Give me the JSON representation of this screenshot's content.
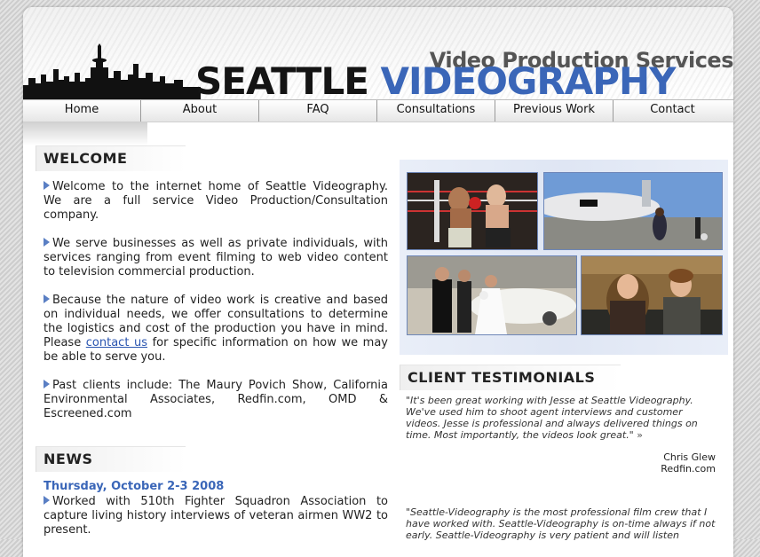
{
  "header": {
    "tagline": "Video Production Services",
    "brand_part1": "SEATTLE ",
    "brand_part2": "VIDEOGRAPHY"
  },
  "nav": [
    {
      "label": "Home"
    },
    {
      "label": "About"
    },
    {
      "label": "FAQ"
    },
    {
      "label": "Consultations"
    },
    {
      "label": "Previous Work"
    },
    {
      "label": "Contact"
    }
  ],
  "welcome": {
    "title": "WELCOME",
    "p1": "Welcome to the internet home of Seattle Videography. We are a full service Video Production/Consultation company.",
    "p2": "We serve businesses as well as private individuals, with services ranging from event filming to web video content to television commercial production.",
    "p3_before": "Because the nature of video work is creative and based on individual needs, we offer consultations to determine the logistics and cost of the production you have in mind. Please ",
    "p3_link": "contact us",
    "p3_after": " for specific information on how we may be able to serve you.",
    "p4": "Past clients include: The Maury Povich Show, California Environmental Associates, Redfin.com, OMD & Escreened.com"
  },
  "news": {
    "title": "NEWS",
    "date": "Thursday, October 2-3 2008",
    "text": "Worked with 510th Fighter Squadron Association to capture living history interviews of veteran airmen WW2 to present."
  },
  "testimonials": {
    "title": "CLIENT TESTIMONIALS",
    "quote1": "\"It's been great working with Jesse at Seattle Videography. We've used him to shoot agent interviews and customer videos. Jesse is professional and always delivered things on time. Most importantly, the videos look great.\"",
    "more_icon": "double-chevron-right-icon",
    "author1_name": "Chris Glew",
    "author1_company": "Redfin.com",
    "quote2": "\"Seattle-Videography is the most professional film crew that I have worked with. Seattle-Videography is on-time always if not early. Seattle-Videography is very patient and will listen"
  },
  "colors": {
    "brand_blue": "#3a66b8",
    "link": "#2a55b0"
  }
}
